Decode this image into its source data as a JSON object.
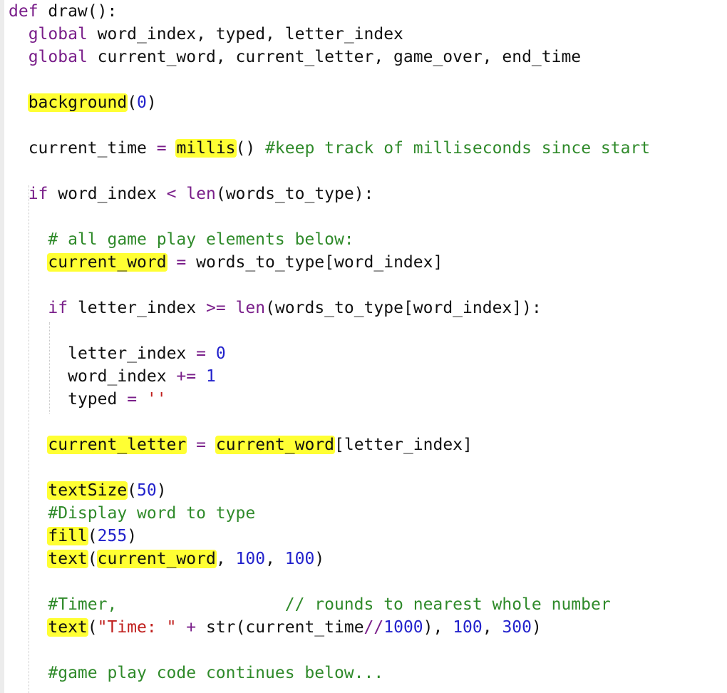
{
  "editor": {
    "lines": [
      {
        "indent": 0,
        "tokens": [
          {
            "c": "kw",
            "t": "def"
          },
          {
            "c": "plain",
            "t": " draw():"
          }
        ]
      },
      {
        "indent": 2,
        "tokens": [
          {
            "c": "kw",
            "t": "global"
          },
          {
            "c": "plain",
            "t": " word_index, typed, letter_index"
          }
        ]
      },
      {
        "indent": 2,
        "tokens": [
          {
            "c": "kw",
            "t": "global"
          },
          {
            "c": "plain",
            "t": " current_word, current_letter, game_over, end_time"
          }
        ]
      },
      {
        "indent": 0,
        "tokens": []
      },
      {
        "indent": 2,
        "tokens": [
          {
            "c": "plain hl",
            "t": "background"
          },
          {
            "c": "plain",
            "t": "("
          },
          {
            "c": "num",
            "t": "0"
          },
          {
            "c": "plain",
            "t": ")"
          }
        ]
      },
      {
        "indent": 0,
        "tokens": []
      },
      {
        "indent": 2,
        "tokens": [
          {
            "c": "plain",
            "t": "current_time "
          },
          {
            "c": "op",
            "t": "="
          },
          {
            "c": "plain",
            "t": " "
          },
          {
            "c": "plain hl",
            "t": "millis"
          },
          {
            "c": "plain",
            "t": "() "
          },
          {
            "c": "cm",
            "t": "#keep track of milliseconds since start"
          }
        ]
      },
      {
        "indent": 0,
        "tokens": []
      },
      {
        "indent": 2,
        "tokens": [
          {
            "c": "kw",
            "t": "if"
          },
          {
            "c": "plain",
            "t": " word_index "
          },
          {
            "c": "op",
            "t": "<"
          },
          {
            "c": "plain",
            "t": " "
          },
          {
            "c": "fn",
            "t": "len"
          },
          {
            "c": "plain",
            "t": "(words_to_type):"
          }
        ]
      },
      {
        "indent": 0,
        "tokens": []
      },
      {
        "indent": 4,
        "tokens": [
          {
            "c": "cm",
            "t": "# all game play elements below:"
          }
        ]
      },
      {
        "indent": 4,
        "tokens": [
          {
            "c": "plain hl",
            "t": "current_word"
          },
          {
            "c": "plain",
            "t": " "
          },
          {
            "c": "op",
            "t": "="
          },
          {
            "c": "plain",
            "t": " words_to_type[word_index]"
          }
        ]
      },
      {
        "indent": 0,
        "tokens": []
      },
      {
        "indent": 4,
        "tokens": [
          {
            "c": "kw",
            "t": "if"
          },
          {
            "c": "plain",
            "t": " letter_index "
          },
          {
            "c": "op",
            "t": ">="
          },
          {
            "c": "plain",
            "t": " "
          },
          {
            "c": "fn",
            "t": "len"
          },
          {
            "c": "plain",
            "t": "(words_to_type[word_index]):"
          }
        ]
      },
      {
        "indent": 0,
        "tokens": []
      },
      {
        "indent": 6,
        "tokens": [
          {
            "c": "plain",
            "t": "letter_index "
          },
          {
            "c": "op",
            "t": "="
          },
          {
            "c": "plain",
            "t": " "
          },
          {
            "c": "num",
            "t": "0"
          }
        ]
      },
      {
        "indent": 6,
        "tokens": [
          {
            "c": "plain",
            "t": "word_index "
          },
          {
            "c": "op",
            "t": "+="
          },
          {
            "c": "plain",
            "t": " "
          },
          {
            "c": "num",
            "t": "1"
          }
        ]
      },
      {
        "indent": 6,
        "tokens": [
          {
            "c": "plain",
            "t": "typed "
          },
          {
            "c": "op",
            "t": "="
          },
          {
            "c": "plain",
            "t": " "
          },
          {
            "c": "str",
            "t": "''"
          }
        ]
      },
      {
        "indent": 0,
        "tokens": []
      },
      {
        "indent": 4,
        "tokens": [
          {
            "c": "plain hl",
            "t": "current_letter"
          },
          {
            "c": "plain",
            "t": " "
          },
          {
            "c": "op",
            "t": "="
          },
          {
            "c": "plain",
            "t": " "
          },
          {
            "c": "plain hl",
            "t": "current_word"
          },
          {
            "c": "plain",
            "t": "[letter_index]"
          }
        ]
      },
      {
        "indent": 0,
        "tokens": []
      },
      {
        "indent": 4,
        "tokens": [
          {
            "c": "plain hl",
            "t": "textSize"
          },
          {
            "c": "plain",
            "t": "("
          },
          {
            "c": "num",
            "t": "50"
          },
          {
            "c": "plain",
            "t": ")"
          }
        ]
      },
      {
        "indent": 4,
        "tokens": [
          {
            "c": "cm",
            "t": "#Display word to type"
          }
        ]
      },
      {
        "indent": 4,
        "tokens": [
          {
            "c": "plain hl",
            "t": "fill"
          },
          {
            "c": "plain",
            "t": "("
          },
          {
            "c": "num",
            "t": "255"
          },
          {
            "c": "plain",
            "t": ")"
          }
        ]
      },
      {
        "indent": 4,
        "tokens": [
          {
            "c": "plain hl",
            "t": "text"
          },
          {
            "c": "plain",
            "t": "("
          },
          {
            "c": "plain hl",
            "t": "current_word"
          },
          {
            "c": "plain",
            "t": ", "
          },
          {
            "c": "num",
            "t": "100"
          },
          {
            "c": "plain",
            "t": ", "
          },
          {
            "c": "num",
            "t": "100"
          },
          {
            "c": "plain",
            "t": ")"
          }
        ]
      },
      {
        "indent": 0,
        "tokens": []
      },
      {
        "indent": 4,
        "tokens": [
          {
            "c": "cm",
            "t": "#Timer,                 // rounds to nearest whole number"
          }
        ]
      },
      {
        "indent": 4,
        "tokens": [
          {
            "c": "plain hl",
            "t": "text"
          },
          {
            "c": "plain",
            "t": "("
          },
          {
            "c": "str",
            "t": "\"Time: \""
          },
          {
            "c": "plain",
            "t": " "
          },
          {
            "c": "op",
            "t": "+"
          },
          {
            "c": "plain",
            "t": " str(current_time"
          },
          {
            "c": "op",
            "t": "//"
          },
          {
            "c": "num",
            "t": "1000"
          },
          {
            "c": "plain",
            "t": "), "
          },
          {
            "c": "num",
            "t": "100"
          },
          {
            "c": "plain",
            "t": ", "
          },
          {
            "c": "num",
            "t": "300"
          },
          {
            "c": "plain",
            "t": ")"
          }
        ]
      },
      {
        "indent": 0,
        "tokens": []
      },
      {
        "indent": 4,
        "tokens": [
          {
            "c": "cm",
            "t": "#game play code continues below..."
          }
        ]
      }
    ]
  }
}
